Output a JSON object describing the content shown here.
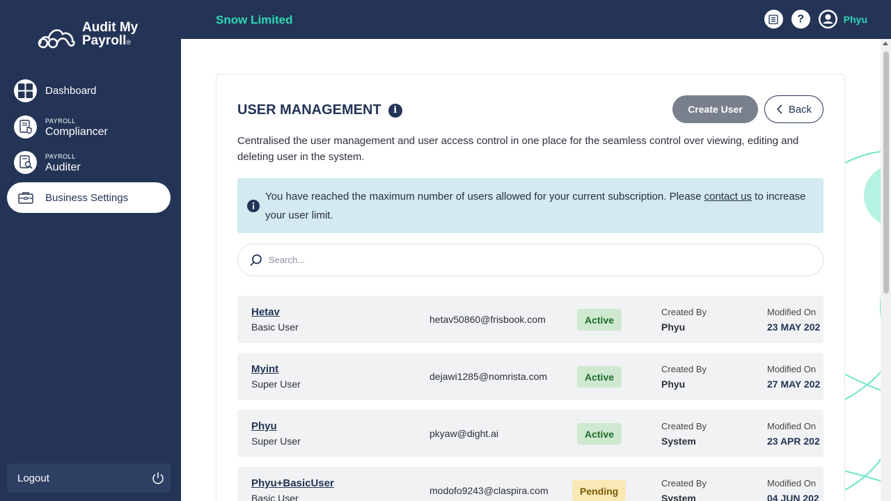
{
  "app": {
    "logo_line1": "Audit My",
    "logo_line2": "Payroll",
    "logo_reg": "®",
    "company": "Snow Limited"
  },
  "sidebar": {
    "items": [
      {
        "label": "Dashboard",
        "icon": "grid-icon"
      },
      {
        "small": "PAYROLL",
        "label": "Compliancer",
        "icon": "document-shield-icon"
      },
      {
        "small": "PAYROLL",
        "label": "Auditer",
        "icon": "document-search-icon"
      },
      {
        "label": "Business Settings",
        "icon": "briefcase-icon",
        "active": true
      }
    ],
    "logout_label": "Logout"
  },
  "topbar": {
    "user_name": "Phyu",
    "icons": [
      "notes-icon",
      "help-icon",
      "user-icon"
    ],
    "help_glyph": "?"
  },
  "page": {
    "title": "USER MANAGEMENT",
    "info_glyph": "i",
    "create_label": "Create User",
    "back_label": "Back",
    "description": "Centralised the user management and user access control in one place for the seamless control over viewing, editing and deleting user in the system.",
    "alert_text": "You have reached the maximum number of users allowed for your current subscription. Please ",
    "alert_link": "contact us",
    "alert_text_end": " to increase your user limit.",
    "search_placeholder": "Search..."
  },
  "users": [
    {
      "name": "Hetav",
      "role": "Basic User",
      "email": "hetav50860@frisbook.com",
      "status": "Active",
      "created_label": "Created By",
      "created_by": "Phyu",
      "modified_label": "Modified On",
      "modified_on": "23 MAY 202"
    },
    {
      "name": "Myint",
      "role": "Super User",
      "email": "dejawi1285@nomrista.com",
      "status": "Active",
      "created_label": "Created By",
      "created_by": "Phyu",
      "modified_label": "Modified On",
      "modified_on": "27 MAY 202"
    },
    {
      "name": "Phyu",
      "role": "Super User",
      "email": "pkyaw@dight.ai",
      "status": "Active",
      "created_label": "Created By",
      "created_by": "System",
      "modified_label": "Modified On",
      "modified_on": "23 APR 202"
    },
    {
      "name": "Phyu+BasicUser",
      "role": "Basic User",
      "email": "modofo9243@claspira.com",
      "status": "Pending",
      "created_label": "Created By",
      "created_by": "System",
      "modified_label": "Modified On",
      "modified_on": "04 JUN 202"
    }
  ],
  "colors": {
    "navy": "#233456",
    "accent": "#2fd6b2",
    "active_badge": "#cfe9d0",
    "pending_badge": "#fbe9b5",
    "alert_bg": "#d2eaf0"
  }
}
